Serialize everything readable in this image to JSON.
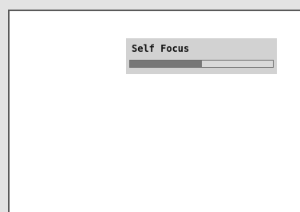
{
  "dialog": {
    "title": "Self Focus",
    "progress_fraction": 0.5
  },
  "colors": {
    "panel": "#d2d2d2",
    "progress_fill": "#777777",
    "window_bg": "#ffffff"
  }
}
